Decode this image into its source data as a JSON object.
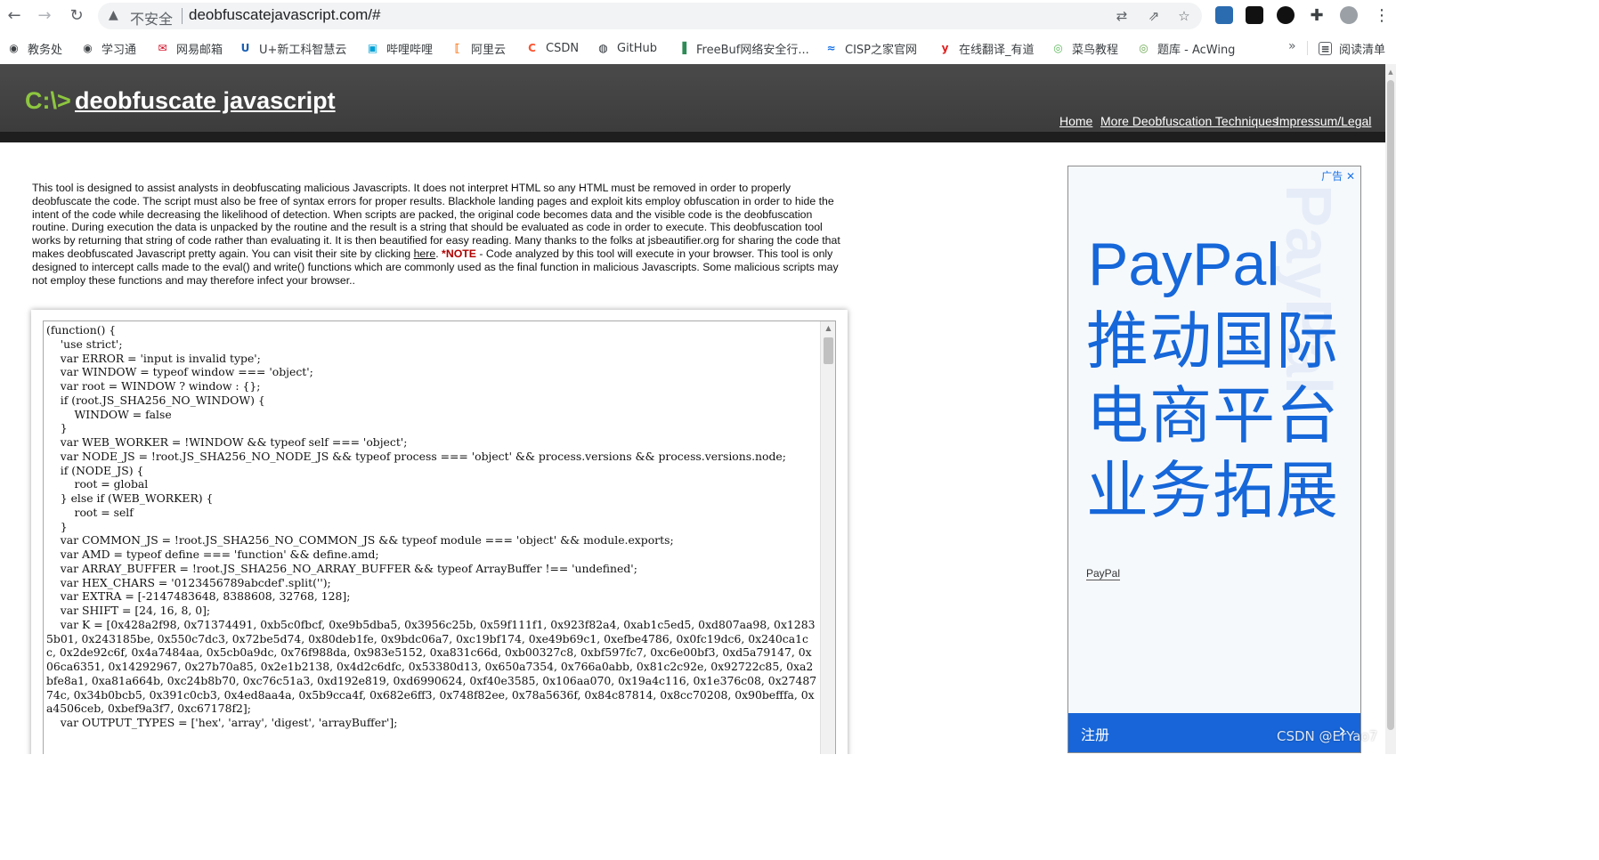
{
  "browser": {
    "back_icon": "arrow-left-icon",
    "forward_icon": "arrow-right-icon",
    "reload_icon": "reload-icon",
    "security_label": "不安全",
    "url": "deobfuscatejavascript.com/#",
    "toolbar_icons": [
      "translate-icon",
      "share-icon",
      "star-icon",
      "download-ext-icon",
      "ext-game-icon",
      "ext-circle-icon",
      "puzzle-icon",
      "profile-icon",
      "more-icon"
    ]
  },
  "bookmarks": [
    {
      "label": "教务处",
      "color": "#3c4043",
      "glyph": "◉"
    },
    {
      "label": "学习通",
      "color": "#3c4043",
      "glyph": "◉"
    },
    {
      "label": "网易邮箱",
      "color": "#d0021b",
      "glyph": "✉"
    },
    {
      "label": "U+新工科智慧云",
      "color": "#1a5fb4",
      "glyph": "U"
    },
    {
      "label": "哔哩哔哩",
      "color": "#00a1d6",
      "glyph": "▣"
    },
    {
      "label": "阿里云",
      "color": "#ff6a00",
      "glyph": "⟦"
    },
    {
      "label": "CSDN",
      "color": "#fc5531",
      "glyph": "C"
    },
    {
      "label": "GitHub",
      "color": "#24292f",
      "glyph": "◍"
    },
    {
      "label": "FreeBuf网络安全行...",
      "color": "#2e8b57",
      "glyph": "▐"
    },
    {
      "label": "CISP之家官网",
      "color": "#1a73e8",
      "glyph": "≈"
    },
    {
      "label": "在线翻译_有道",
      "color": "#e02020",
      "glyph": "y"
    },
    {
      "label": "菜鸟教程",
      "color": "#5cb85c",
      "glyph": "◎"
    },
    {
      "label": "题库 - AcWing",
      "color": "#6aa84f",
      "glyph": "◎"
    }
  ],
  "bookmarks_more": "»",
  "reading_list": "阅读清单",
  "site": {
    "prompt": "C:\\>",
    "title": "deobfuscate javascript",
    "nav": [
      "Home",
      "More Deobfuscation Techniques",
      "Impressum/Legal"
    ]
  },
  "intro": {
    "part1": "This tool is designed to assist analysts in deobfuscating malicious Javascripts. It does not interpret HTML so any HTML must be removed in order to properly deobfuscate the code. The script must also be free of syntax errors for proper results. Blackhole landing pages and exploit kits employ obfuscation in order to hide the intent of the code while decreasing the likelihood of detection. When scripts are packed, the original code becomes data and the visible code is the deobfuscation routine. During execution the data is unpacked by the routine and the result is a string that should be evaluated as code in order to execute. This deobfuscation tool works by returning that string of code rather than evaluating it. It is then beautified for easy reading. Many thanks to the folks at jsbeautifier.org for sharing the code that makes deobfuscated Javascript pretty again. You can visit their site by clicking ",
    "link": "here",
    "part2": ". ",
    "note": "*NOTE",
    "part3": " - Code analyzed by this tool will execute in your browser. This tool is only designed to intercept calls made to the eval() and write() functions which are commonly used as the final function in malicious Javascripts. Some malicious scripts may not employ these functions and may therefore infect your browser.."
  },
  "code": "(function() {\n    'use strict';\n    var ERROR = 'input is invalid type';\n    var WINDOW = typeof window === 'object';\n    var root = WINDOW ? window : {};\n    if (root.JS_SHA256_NO_WINDOW) {\n        WINDOW = false\n    }\n    var WEB_WORKER = !WINDOW && typeof self === 'object';\n    var NODE_JS = !root.JS_SHA256_NO_NODE_JS && typeof process === 'object' && process.versions && process.versions.node;\n    if (NODE_JS) {\n        root = global\n    } else if (WEB_WORKER) {\n        root = self\n    }\n    var COMMON_JS = !root.JS_SHA256_NO_COMMON_JS && typeof module === 'object' && module.exports;\n    var AMD = typeof define === 'function' && define.amd;\n    var ARRAY_BUFFER = !root.JS_SHA256_NO_ARRAY_BUFFER && typeof ArrayBuffer !== 'undefined';\n    var HEX_CHARS = '0123456789abcdef'.split('');\n    var EXTRA = [-2147483648, 8388608, 32768, 128];\n    var SHIFT = [24, 16, 8, 0];\n    var K = [0x428a2f98, 0x71374491, 0xb5c0fbcf, 0xe9b5dba5, 0x3956c25b, 0x59f111f1, 0x923f82a4, 0xab1c5ed5, 0xd807aa98, 0x12835b01, 0x243185be, 0x550c7dc3, 0x72be5d74, 0x80deb1fe, 0x9bdc06a7, 0xc19bf174, 0xe49b69c1, 0xefbe4786, 0x0fc19dc6, 0x240ca1cc, 0x2de92c6f, 0x4a7484aa, 0x5cb0a9dc, 0x76f988da, 0x983e5152, 0xa831c66d, 0xb00327c8, 0xbf597fc7, 0xc6e00bf3, 0xd5a79147, 0x06ca6351, 0x14292967, 0x27b70a85, 0x2e1b2138, 0x4d2c6dfc, 0x53380d13, 0x650a7354, 0x766a0abb, 0x81c2c92e, 0x92722c85, 0xa2bfe8a1, 0xa81a664b, 0xc24b8b70, 0xc76c51a3, 0xd192e819, 0xd6990624, 0xf40e3585, 0x106aa070, 0x19a4c116, 0x1e376c08, 0x2748774c, 0x34b0bcb5, 0x391c0cb3, 0x4ed8aa4a, 0x5b9cca4f, 0x682e6ff3, 0x748f82ee, 0x78a5636f, 0x84c87814, 0x8cc70208, 0x90befffa, 0xa4506ceb, 0xbef9a3f7, 0xc67178f2];\n    var OUTPUT_TYPES = ['hex', 'array', 'digest', 'arrayBuffer'];",
  "ad": {
    "tag": "广告",
    "close_icon": "close-icon",
    "watermark": "PayPal",
    "brand": "PayPal",
    "lines": [
      "推动国际",
      "电商平台",
      "业务拓展"
    ],
    "source": "PayPal",
    "cta": "注册",
    "cta_icon": "chevron-right-icon",
    "accent": "#1667d9"
  },
  "watermark": "CSDN @ErYao7"
}
